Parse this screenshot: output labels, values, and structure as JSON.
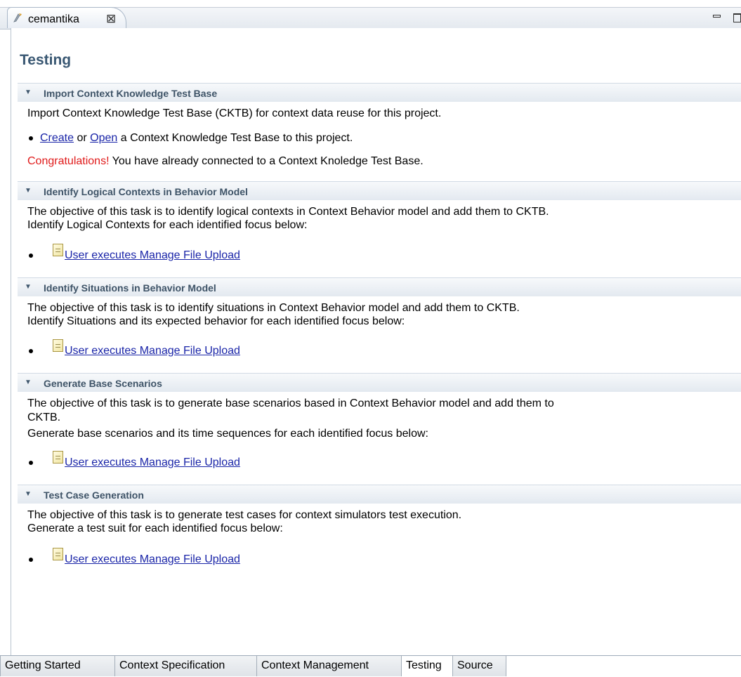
{
  "editor_tab": {
    "title": "cemantika",
    "close_glyph": "⊠"
  },
  "form": {
    "title": "Testing"
  },
  "sections": [
    {
      "title": "Import Context Knowledge Test Base",
      "description": "Import Context Knowledge Test Base (CKTB) for context data reuse for this project.",
      "link_create": "Create",
      "link_sep": " or ",
      "link_open": "Open",
      "link_suffix": " a Context Knowledge Test Base to this project.",
      "status_highlight": "Congratulations!",
      "status_text": " You have already connected to a Context Knoledge Test Base."
    },
    {
      "title": "Identify Logical Contexts in Behavior Model",
      "lines": [
        "The objective of this task is to identify logical contexts in Context Behavior model and add them to CKTB.",
        "Identify Logical Contexts for each identified focus below:"
      ],
      "focus_link": "User executes Manage File Upload"
    },
    {
      "title": "Identify Situations in Behavior Model",
      "lines": [
        "The objective of this task is to identify situations in Context Behavior model and add them to CKTB.",
        "Identify Situations and its expected behavior for each identified focus below:"
      ],
      "focus_link": "User executes Manage File Upload"
    },
    {
      "title": "Generate Base Scenarios",
      "lines": [
        "The objective of this task is to generate base scenarios based in Context Behavior model and add them to",
        "CKTB.",
        "Generate base scenarios and its time sequences for each identified focus below:"
      ],
      "focus_link": "User executes Manage File Upload"
    },
    {
      "title": "Test Case Generation",
      "lines": [
        "The objective of this task is to generate test cases for context simulators test execution.",
        "Generate a test suit for each identified focus below:"
      ],
      "focus_link": "User executes Manage File Upload"
    }
  ],
  "bottom_tabs": [
    "Getting Started",
    "Context Specification",
    "Context Management",
    "Testing",
    "Source"
  ],
  "active_tab": "Testing",
  "colors": {
    "title": "#3a5873",
    "section_title": "#3e5367",
    "link": "#1a25a8",
    "congrats": "#e01a1a"
  },
  "icons": {
    "editor_tab": "pdf-tool-icon",
    "focus_item": "document-icon",
    "twisty": "triangle-down-icon"
  }
}
